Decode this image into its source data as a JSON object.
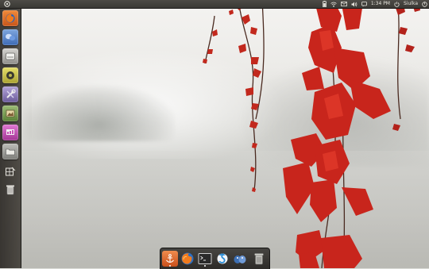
{
  "top_panel": {
    "logo_icon": "ubuntu-logo-icon",
    "time": "1:34 PM",
    "user_name": "Siulka",
    "indicator_icons": [
      "battery-icon",
      "network-icon",
      "mail-icon",
      "volume-icon",
      "messaging-icon",
      "chat-icon",
      "keyboard-icon"
    ],
    "session_icon": "power-icon"
  },
  "launcher": {
    "items": [
      {
        "name": "firefox",
        "icon": "firefox-icon",
        "color": "#e06a1c"
      },
      {
        "name": "empathy",
        "icon": "chat-bubbles-icon",
        "color": "#4d7fc7"
      },
      {
        "name": "nautilus",
        "icon": "drive-icon",
        "color": "#a7a7a3"
      },
      {
        "name": "rhythmbox",
        "icon": "speaker-icon",
        "color": "#c9c34a"
      },
      {
        "name": "settings",
        "icon": "tools-icon",
        "color": "#8a79b6"
      },
      {
        "name": "gimp",
        "icon": "image-editor-icon",
        "color": "#6f9a4c"
      },
      {
        "name": "presentation",
        "icon": "presentation-icon",
        "color": "#c64fb5"
      },
      {
        "name": "files",
        "icon": "folder-icon",
        "color": "#9b9b97"
      },
      {
        "name": "workspaces",
        "icon": "workspace-switcher-icon",
        "color": ""
      },
      {
        "name": "trash",
        "icon": "trash-icon",
        "color": ""
      }
    ]
  },
  "dock": {
    "items": [
      {
        "name": "anchor",
        "icon": "anchor-icon",
        "color": "#e36b2b"
      },
      {
        "name": "firefox",
        "icon": "firefox-icon",
        "color": "#2c6fc2"
      },
      {
        "name": "terminal",
        "icon": "terminal-icon",
        "color": "#2a2a2a"
      },
      {
        "name": "skype",
        "icon": "skype-icon",
        "color": "#2d8ed6"
      },
      {
        "name": "pidgin",
        "icon": "pidgin-icon",
        "color": "#3d6fb3"
      },
      {
        "name": "trash",
        "icon": "trash-icon",
        "color": "#8e8e8a"
      }
    ]
  }
}
